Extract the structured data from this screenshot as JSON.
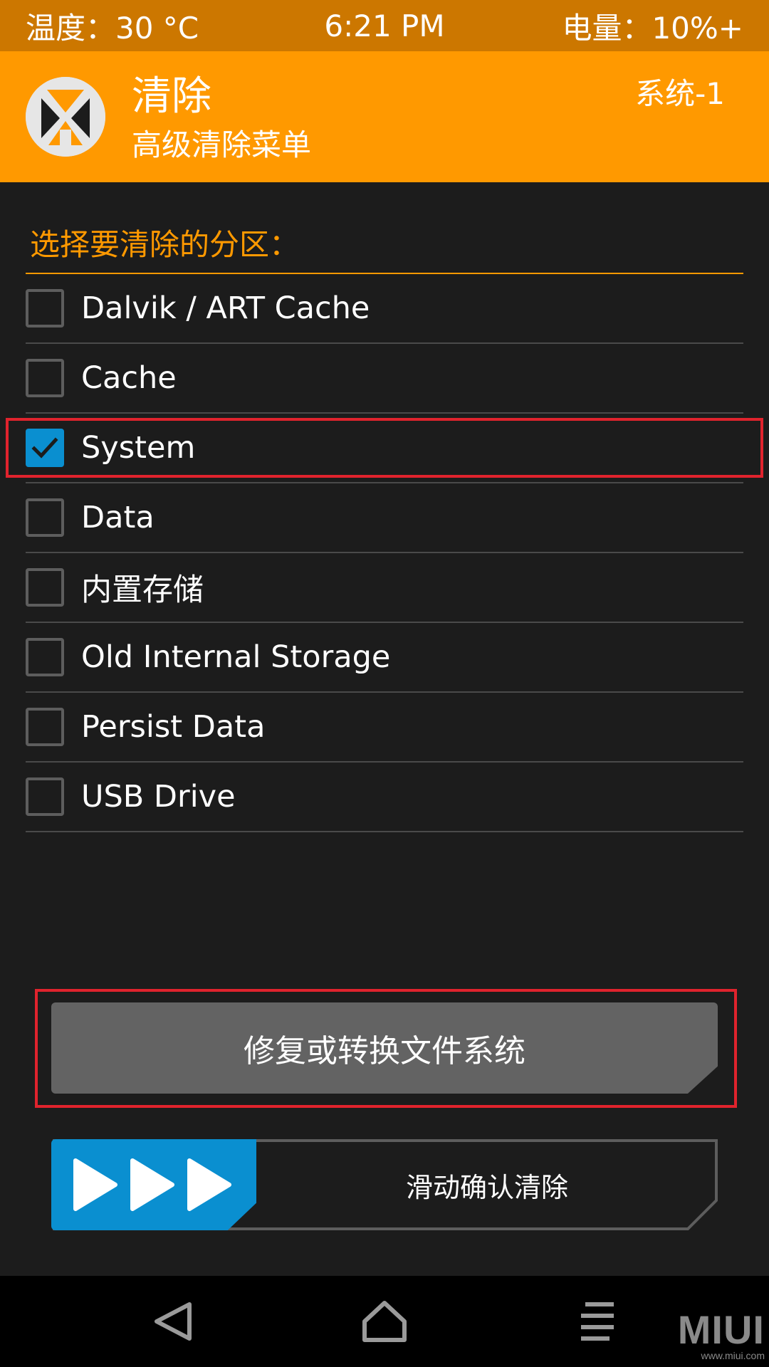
{
  "status_bar": {
    "temperature": "温度：30 °C",
    "time": "6:21 PM",
    "battery": "电量：10%+"
  },
  "header": {
    "title": "清除",
    "subtitle": "高级清除菜单",
    "system_slot": "系统-1",
    "logo_icon": "twrp-logo-icon"
  },
  "section": {
    "label": "选择要清除的分区："
  },
  "partitions": [
    {
      "label": "Dalvik / ART Cache",
      "checked": false
    },
    {
      "label": "Cache",
      "checked": false
    },
    {
      "label": "System",
      "checked": true
    },
    {
      "label": "Data",
      "checked": false
    },
    {
      "label": "内置存储",
      "checked": false
    },
    {
      "label": "Old Internal Storage",
      "checked": false
    },
    {
      "label": "Persist Data",
      "checked": false
    },
    {
      "label": "USB Drive",
      "checked": false
    }
  ],
  "repair_button": {
    "label": "修复或转换文件系统"
  },
  "slider": {
    "label": "滑动确认清除"
  },
  "nav": {
    "back_icon": "back-triangle-icon",
    "home_icon": "home-icon",
    "menu_icon": "menu-lines-icon"
  },
  "watermark": {
    "brand": "MIUI",
    "site": "www.miui.com"
  },
  "colors": {
    "accent": "#ff9900",
    "status_bar": "#cc7700",
    "checkbox_checked": "#0a8fd0",
    "highlight": "#e0232d"
  }
}
